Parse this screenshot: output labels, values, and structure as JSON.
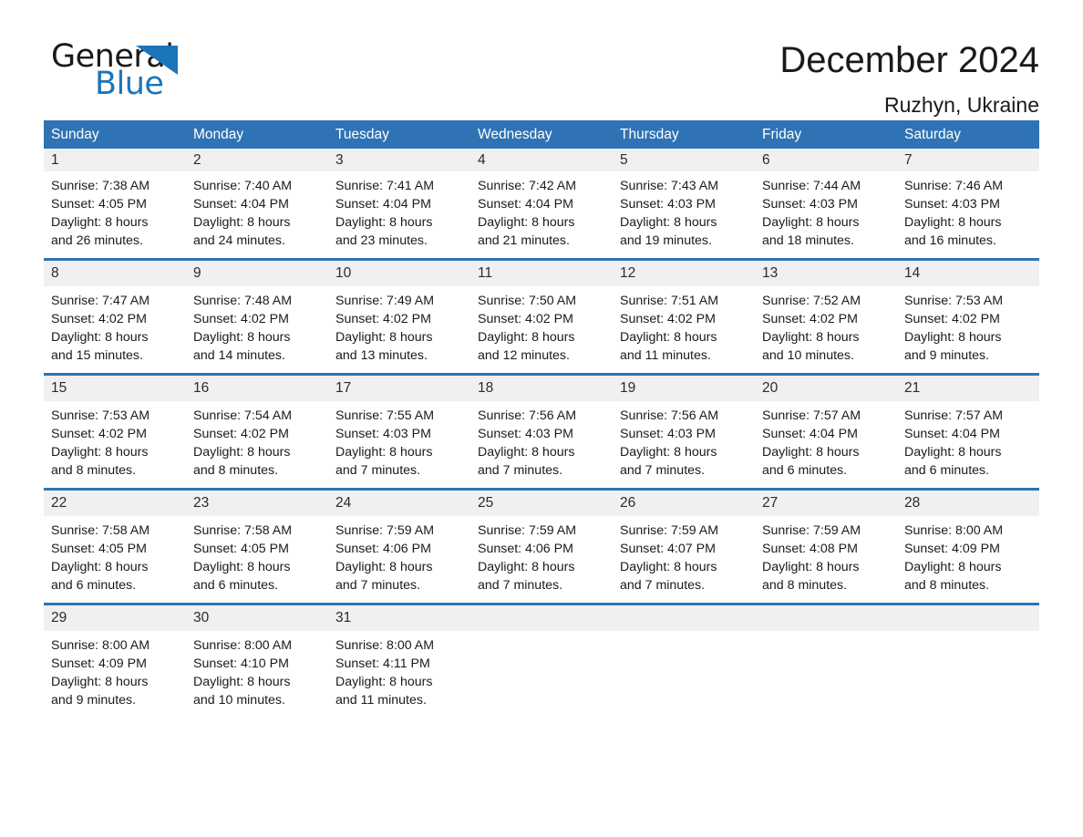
{
  "brand": {
    "name_part1": "General",
    "name_part2": "Blue",
    "accent_color": "#1b75bb",
    "triangle_icon": "triangle-icon"
  },
  "header": {
    "title": "December 2024",
    "location": "Ruzhyn, Ukraine"
  },
  "theme": {
    "header_blue": "#2f73b4",
    "date_band_gray": "#f0f0f0",
    "text_color": "#1a1a1a"
  },
  "calendar": {
    "weekdays": [
      "Sunday",
      "Monday",
      "Tuesday",
      "Wednesday",
      "Thursday",
      "Friday",
      "Saturday"
    ],
    "weeks": [
      {
        "days": [
          {
            "date": "1",
            "lines": [
              "Sunrise: 7:38 AM",
              "Sunset: 4:05 PM",
              "Daylight: 8 hours",
              "and 26 minutes."
            ]
          },
          {
            "date": "2",
            "lines": [
              "Sunrise: 7:40 AM",
              "Sunset: 4:04 PM",
              "Daylight: 8 hours",
              "and 24 minutes."
            ]
          },
          {
            "date": "3",
            "lines": [
              "Sunrise: 7:41 AM",
              "Sunset: 4:04 PM",
              "Daylight: 8 hours",
              "and 23 minutes."
            ]
          },
          {
            "date": "4",
            "lines": [
              "Sunrise: 7:42 AM",
              "Sunset: 4:04 PM",
              "Daylight: 8 hours",
              "and 21 minutes."
            ]
          },
          {
            "date": "5",
            "lines": [
              "Sunrise: 7:43 AM",
              "Sunset: 4:03 PM",
              "Daylight: 8 hours",
              "and 19 minutes."
            ]
          },
          {
            "date": "6",
            "lines": [
              "Sunrise: 7:44 AM",
              "Sunset: 4:03 PM",
              "Daylight: 8 hours",
              "and 18 minutes."
            ]
          },
          {
            "date": "7",
            "lines": [
              "Sunrise: 7:46 AM",
              "Sunset: 4:03 PM",
              "Daylight: 8 hours",
              "and 16 minutes."
            ]
          }
        ]
      },
      {
        "days": [
          {
            "date": "8",
            "lines": [
              "Sunrise: 7:47 AM",
              "Sunset: 4:02 PM",
              "Daylight: 8 hours",
              "and 15 minutes."
            ]
          },
          {
            "date": "9",
            "lines": [
              "Sunrise: 7:48 AM",
              "Sunset: 4:02 PM",
              "Daylight: 8 hours",
              "and 14 minutes."
            ]
          },
          {
            "date": "10",
            "lines": [
              "Sunrise: 7:49 AM",
              "Sunset: 4:02 PM",
              "Daylight: 8 hours",
              "and 13 minutes."
            ]
          },
          {
            "date": "11",
            "lines": [
              "Sunrise: 7:50 AM",
              "Sunset: 4:02 PM",
              "Daylight: 8 hours",
              "and 12 minutes."
            ]
          },
          {
            "date": "12",
            "lines": [
              "Sunrise: 7:51 AM",
              "Sunset: 4:02 PM",
              "Daylight: 8 hours",
              "and 11 minutes."
            ]
          },
          {
            "date": "13",
            "lines": [
              "Sunrise: 7:52 AM",
              "Sunset: 4:02 PM",
              "Daylight: 8 hours",
              "and 10 minutes."
            ]
          },
          {
            "date": "14",
            "lines": [
              "Sunrise: 7:53 AM",
              "Sunset: 4:02 PM",
              "Daylight: 8 hours",
              "and 9 minutes."
            ]
          }
        ]
      },
      {
        "days": [
          {
            "date": "15",
            "lines": [
              "Sunrise: 7:53 AM",
              "Sunset: 4:02 PM",
              "Daylight: 8 hours",
              "and 8 minutes."
            ]
          },
          {
            "date": "16",
            "lines": [
              "Sunrise: 7:54 AM",
              "Sunset: 4:02 PM",
              "Daylight: 8 hours",
              "and 8 minutes."
            ]
          },
          {
            "date": "17",
            "lines": [
              "Sunrise: 7:55 AM",
              "Sunset: 4:03 PM",
              "Daylight: 8 hours",
              "and 7 minutes."
            ]
          },
          {
            "date": "18",
            "lines": [
              "Sunrise: 7:56 AM",
              "Sunset: 4:03 PM",
              "Daylight: 8 hours",
              "and 7 minutes."
            ]
          },
          {
            "date": "19",
            "lines": [
              "Sunrise: 7:56 AM",
              "Sunset: 4:03 PM",
              "Daylight: 8 hours",
              "and 7 minutes."
            ]
          },
          {
            "date": "20",
            "lines": [
              "Sunrise: 7:57 AM",
              "Sunset: 4:04 PM",
              "Daylight: 8 hours",
              "and 6 minutes."
            ]
          },
          {
            "date": "21",
            "lines": [
              "Sunrise: 7:57 AM",
              "Sunset: 4:04 PM",
              "Daylight: 8 hours",
              "and 6 minutes."
            ]
          }
        ]
      },
      {
        "days": [
          {
            "date": "22",
            "lines": [
              "Sunrise: 7:58 AM",
              "Sunset: 4:05 PM",
              "Daylight: 8 hours",
              "and 6 minutes."
            ]
          },
          {
            "date": "23",
            "lines": [
              "Sunrise: 7:58 AM",
              "Sunset: 4:05 PM",
              "Daylight: 8 hours",
              "and 6 minutes."
            ]
          },
          {
            "date": "24",
            "lines": [
              "Sunrise: 7:59 AM",
              "Sunset: 4:06 PM",
              "Daylight: 8 hours",
              "and 7 minutes."
            ]
          },
          {
            "date": "25",
            "lines": [
              "Sunrise: 7:59 AM",
              "Sunset: 4:06 PM",
              "Daylight: 8 hours",
              "and 7 minutes."
            ]
          },
          {
            "date": "26",
            "lines": [
              "Sunrise: 7:59 AM",
              "Sunset: 4:07 PM",
              "Daylight: 8 hours",
              "and 7 minutes."
            ]
          },
          {
            "date": "27",
            "lines": [
              "Sunrise: 7:59 AM",
              "Sunset: 4:08 PM",
              "Daylight: 8 hours",
              "and 8 minutes."
            ]
          },
          {
            "date": "28",
            "lines": [
              "Sunrise: 8:00 AM",
              "Sunset: 4:09 PM",
              "Daylight: 8 hours",
              "and 8 minutes."
            ]
          }
        ]
      },
      {
        "days": [
          {
            "date": "29",
            "lines": [
              "Sunrise: 8:00 AM",
              "Sunset: 4:09 PM",
              "Daylight: 8 hours",
              "and 9 minutes."
            ]
          },
          {
            "date": "30",
            "lines": [
              "Sunrise: 8:00 AM",
              "Sunset: 4:10 PM",
              "Daylight: 8 hours",
              "and 10 minutes."
            ]
          },
          {
            "date": "31",
            "lines": [
              "Sunrise: 8:00 AM",
              "Sunset: 4:11 PM",
              "Daylight: 8 hours",
              "and 11 minutes."
            ]
          },
          {
            "date": "",
            "lines": []
          },
          {
            "date": "",
            "lines": []
          },
          {
            "date": "",
            "lines": []
          },
          {
            "date": "",
            "lines": []
          }
        ]
      }
    ]
  }
}
